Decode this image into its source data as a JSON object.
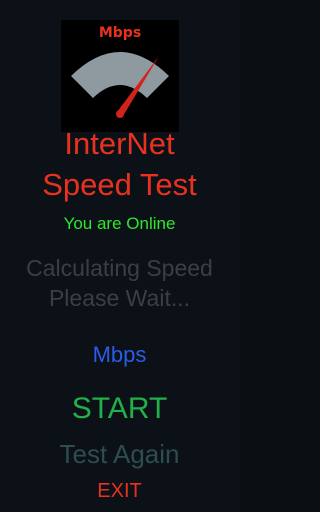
{
  "logo": {
    "label": "Mbps",
    "colors": {
      "background": "#000000",
      "label": "#e8321f",
      "gauge": "#8f9aa0",
      "needle": "#d2231a"
    }
  },
  "title": {
    "line1": "InterNet",
    "line2": "Speed Test"
  },
  "status": "You are Online",
  "calculating": {
    "line1": "Calculating Speed",
    "line2": "Please Wait..."
  },
  "speed_unit": "Mbps",
  "buttons": {
    "start": "START",
    "test_again": "Test Again",
    "exit": "EXIT"
  },
  "colors": {
    "background": "#0c1117",
    "title": "#e8321f",
    "status": "#2ee62e",
    "calculating": "#3a3f45",
    "speed_unit": "#2b5ce6",
    "start": "#22b04a",
    "test_again": "#2d4d4f",
    "exit": "#e8321f"
  }
}
